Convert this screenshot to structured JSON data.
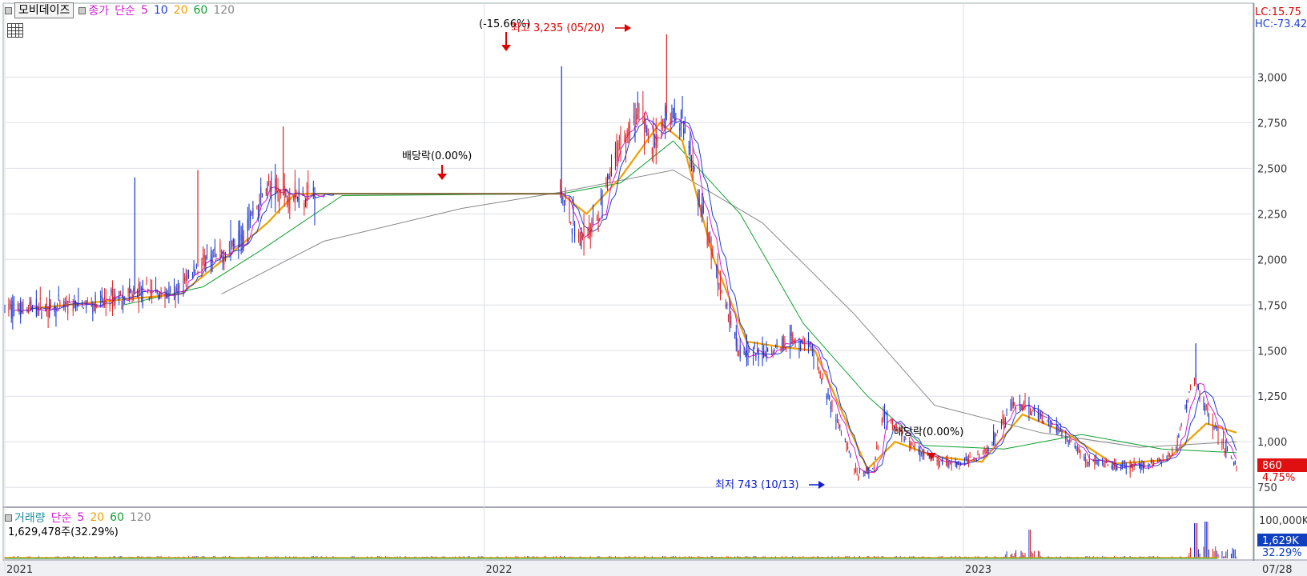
{
  "header": {
    "stock_name": "모비데이즈",
    "price_label": "종가",
    "ma_type": "단순",
    "ma_periods": [
      "5",
      "10",
      "20",
      "60",
      "120"
    ],
    "ma_colors": [
      "#d21fd2",
      "#1f3fd2",
      "#f0a000",
      "#10a030",
      "#888888"
    ],
    "lc_text": "LC:15.75",
    "hc_text": "HC:-73.42"
  },
  "volume_header": {
    "label": "거래량",
    "ma_type": "단순",
    "ma_periods": [
      "5",
      "20",
      "60",
      "120"
    ],
    "ma_colors": [
      "#d21fd2",
      "#f0a000",
      "#10a030",
      "#888888"
    ],
    "current_text": "1,629,478주(32.29%)"
  },
  "chart_data": {
    "type": "candlestick",
    "x_labels": [
      "2021",
      "2022",
      "2023",
      "07/28"
    ],
    "y_ticks": [
      750,
      1000,
      1250,
      1500,
      1750,
      2000,
      2250,
      2500,
      2750,
      3000
    ],
    "y_tick_labels": [
      "750",
      "1,000",
      "1,250",
      "1,500",
      "1,750",
      "2,000",
      "2,250",
      "2,500",
      "2,750",
      "3,000"
    ],
    "ylim": [
      650,
      3300
    ],
    "volume_ticks": [
      "100,000K"
    ],
    "current_price": "860",
    "current_change": "4.75%",
    "current_volume": "1,629K",
    "current_volume_pct": "32.29%",
    "annotations": {
      "high": "최고 3,235 (05/20)",
      "low": "최저 743 (10/13)",
      "gap": "(-15.66%)",
      "dividend1": "배당락(0.00%)",
      "dividend2": "배당락(0.00%)"
    },
    "price_path": [
      {
        "d": "2021-01-04",
        "v": 1730
      },
      {
        "d": "2021-02-15",
        "v": 1740
      },
      {
        "d": "2021-03-15",
        "v": 1760
      },
      {
        "d": "2021-04-01",
        "v": 1800
      },
      {
        "d": "2021-04-20",
        "v": 1820
      },
      {
        "d": "2021-05-10",
        "v": 1800
      },
      {
        "d": "2021-05-25",
        "v": 1950
      },
      {
        "d": "2021-06-15",
        "v": 2020
      },
      {
        "d": "2021-07-01",
        "v": 2150
      },
      {
        "d": "2021-07-20",
        "v": 2400
      },
      {
        "d": "2021-08-01",
        "v": 2350
      },
      {
        "d": "2021-08-20",
        "v": 2360
      },
      {
        "d": "2022-03-01",
        "v": 2360
      },
      {
        "d": "2022-03-15",
        "v": 2100
      },
      {
        "d": "2022-03-30",
        "v": 2250
      },
      {
        "d": "2022-04-15",
        "v": 2650
      },
      {
        "d": "2022-05-01",
        "v": 2800
      },
      {
        "d": "2022-05-10",
        "v": 2600
      },
      {
        "d": "2022-05-20",
        "v": 2800
      },
      {
        "d": "2022-06-01",
        "v": 2750
      },
      {
        "d": "2022-06-15",
        "v": 2300
      },
      {
        "d": "2022-06-30",
        "v": 1850
      },
      {
        "d": "2022-07-15",
        "v": 1500
      },
      {
        "d": "2022-08-01",
        "v": 1480
      },
      {
        "d": "2022-08-20",
        "v": 1560
      },
      {
        "d": "2022-09-05",
        "v": 1540
      },
      {
        "d": "2022-09-20",
        "v": 1250
      },
      {
        "d": "2022-10-13",
        "v": 800
      },
      {
        "d": "2022-10-25",
        "v": 860
      },
      {
        "d": "2022-11-01",
        "v": 1150
      },
      {
        "d": "2022-11-20",
        "v": 1000
      },
      {
        "d": "2022-12-10",
        "v": 890
      },
      {
        "d": "2022-12-30",
        "v": 880
      },
      {
        "d": "2023-01-20",
        "v": 960
      },
      {
        "d": "2023-02-05",
        "v": 1200
      },
      {
        "d": "2023-02-20",
        "v": 1180
      },
      {
        "d": "2023-03-15",
        "v": 1070
      },
      {
        "d": "2023-04-05",
        "v": 900
      },
      {
        "d": "2023-04-25",
        "v": 860
      },
      {
        "d": "2023-05-20",
        "v": 870
      },
      {
        "d": "2023-06-10",
        "v": 930
      },
      {
        "d": "2023-06-25",
        "v": 1350
      },
      {
        "d": "2023-07-10",
        "v": 1100
      },
      {
        "d": "2023-07-28",
        "v": 860
      }
    ],
    "ma20_path": [
      {
        "d": "2021-01-20",
        "v": 1730
      },
      {
        "d": "2021-04-01",
        "v": 1780
      },
      {
        "d": "2021-05-15",
        "v": 1810
      },
      {
        "d": "2021-06-15",
        "v": 1990
      },
      {
        "d": "2021-07-20",
        "v": 2200
      },
      {
        "d": "2021-08-10",
        "v": 2360
      },
      {
        "d": "2022-03-01",
        "v": 2360
      },
      {
        "d": "2022-03-20",
        "v": 2250
      },
      {
        "d": "2022-04-15",
        "v": 2450
      },
      {
        "d": "2022-05-15",
        "v": 2750
      },
      {
        "d": "2022-06-01",
        "v": 2650
      },
      {
        "d": "2022-06-25",
        "v": 2000
      },
      {
        "d": "2022-07-20",
        "v": 1550
      },
      {
        "d": "2022-08-15",
        "v": 1520
      },
      {
        "d": "2022-09-10",
        "v": 1500
      },
      {
        "d": "2022-10-20",
        "v": 850
      },
      {
        "d": "2022-11-10",
        "v": 1000
      },
      {
        "d": "2022-12-10",
        "v": 920
      },
      {
        "d": "2023-01-15",
        "v": 890
      },
      {
        "d": "2023-02-15",
        "v": 1150
      },
      {
        "d": "2023-03-20",
        "v": 1050
      },
      {
        "d": "2023-04-25",
        "v": 880
      },
      {
        "d": "2023-06-05",
        "v": 900
      },
      {
        "d": "2023-07-05",
        "v": 1100
      },
      {
        "d": "2023-07-28",
        "v": 1050
      }
    ],
    "ma60_path": [
      {
        "d": "2021-04-01",
        "v": 1750
      },
      {
        "d": "2021-06-01",
        "v": 1850
      },
      {
        "d": "2021-07-15",
        "v": 2050
      },
      {
        "d": "2021-09-15",
        "v": 2350
      },
      {
        "d": "2022-03-01",
        "v": 2360
      },
      {
        "d": "2022-04-15",
        "v": 2420
      },
      {
        "d": "2022-05-25",
        "v": 2650
      },
      {
        "d": "2022-07-15",
        "v": 2250
      },
      {
        "d": "2022-09-01",
        "v": 1650
      },
      {
        "d": "2022-10-20",
        "v": 1250
      },
      {
        "d": "2022-12-01",
        "v": 980
      },
      {
        "d": "2023-02-01",
        "v": 960
      },
      {
        "d": "2023-04-01",
        "v": 1040
      },
      {
        "d": "2023-06-01",
        "v": 960
      },
      {
        "d": "2023-07-28",
        "v": 940
      }
    ],
    "ma120_path": [
      {
        "d": "2021-06-15",
        "v": 1810
      },
      {
        "d": "2021-09-01",
        "v": 2100
      },
      {
        "d": "2021-12-15",
        "v": 2280
      },
      {
        "d": "2022-03-01",
        "v": 2370
      },
      {
        "d": "2022-05-25",
        "v": 2490
      },
      {
        "d": "2022-08-01",
        "v": 2200
      },
      {
        "d": "2022-10-10",
        "v": 1700
      },
      {
        "d": "2022-12-10",
        "v": 1200
      },
      {
        "d": "2023-03-01",
        "v": 1050
      },
      {
        "d": "2023-05-15",
        "v": 970
      },
      {
        "d": "2023-07-28",
        "v": 1000
      }
    ]
  }
}
